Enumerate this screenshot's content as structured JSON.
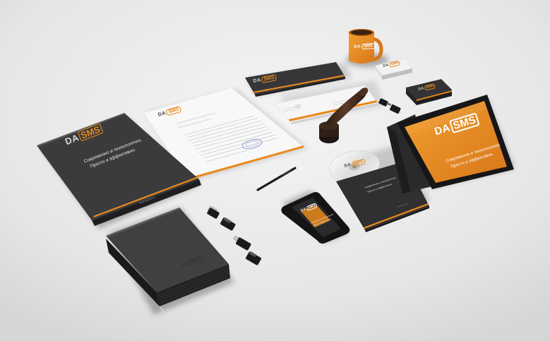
{
  "brand": {
    "logo_prefix": "DA",
    "logo_box": "SMS",
    "tagline_line1": "Современно и технологично.",
    "tagline_line2": "Просто и эффективно.",
    "website": "www.dasms.ru",
    "phone_tagline_line1": "Современно и технологично.",
    "phone_tagline_line2": "Просто и эффективно."
  },
  "colors": {
    "brand_orange": "#e8891c",
    "charcoal": "#3a3a3c",
    "background": "#ececec",
    "paper": "#fafafa"
  },
  "icons": {
    "mug": "coffee-mug-icon",
    "pen": "pen-icon",
    "stamp": "wooden-stamp-icon",
    "usb": "usb-flash-drive-icon",
    "tablet": "tablet-icon",
    "phone": "smartphone-icon",
    "cd": "compact-disc-icon",
    "notebook": "notebook-icon"
  }
}
